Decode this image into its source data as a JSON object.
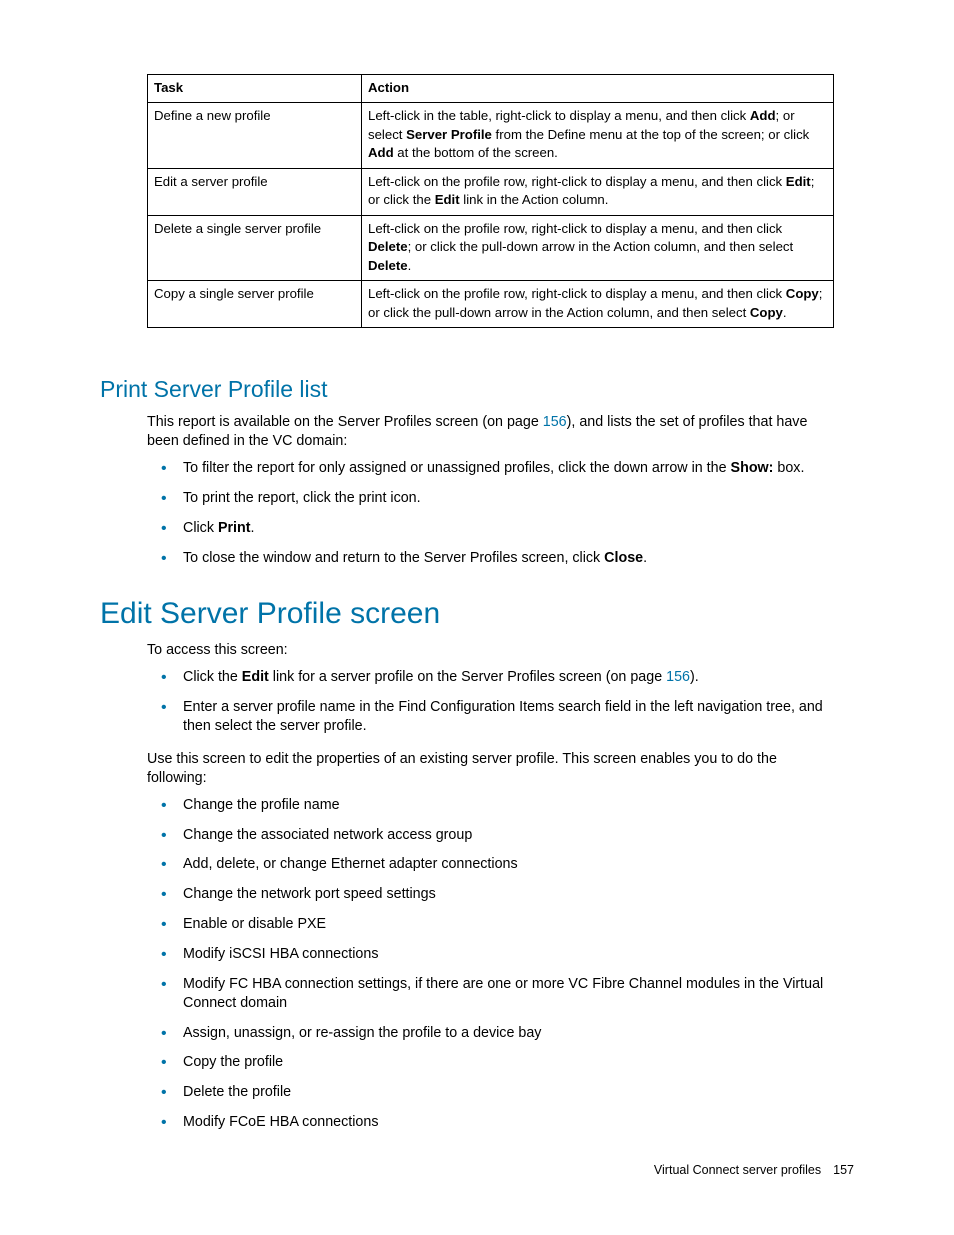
{
  "table": {
    "headers": {
      "task": "Task",
      "action": "Action"
    },
    "rows": [
      {
        "task": "Define a new profile",
        "action_pre1": "Left-click in the table, right-click to display a menu, and then click ",
        "action_b1": "Add",
        "action_mid1": "; or select ",
        "action_b2": "Server Profile",
        "action_mid2": " from the Define menu at the top of the screen; or click ",
        "action_b3": "Add",
        "action_post": " at the bottom of the screen."
      },
      {
        "task": "Edit a server profile",
        "action_pre1": "Left-click on the profile row, right-click to display a menu, and then click ",
        "action_b1": "Edit",
        "action_mid1": "; or click the ",
        "action_b2": "Edit",
        "action_post": " link in the Action column."
      },
      {
        "task": "Delete a single server profile",
        "action_pre1": "Left-click on the profile row, right-click to display a menu, and then click ",
        "action_b1": "Delete",
        "action_mid1": "; or click the pull-down arrow in the Action column, and then select ",
        "action_b2": "Delete",
        "action_post": "."
      },
      {
        "task": "Copy a single server profile",
        "action_pre1": "Left-click on the profile row, right-click to display a menu, and then click ",
        "action_b1": "Copy",
        "action_mid1": "; or click the pull-down arrow in the Action column, and then select ",
        "action_b2": "Copy",
        "action_post": "."
      }
    ]
  },
  "print_section": {
    "title": "Print Server Profile list",
    "intro_pre": "This report is available on the Server Profiles screen (on page ",
    "intro_link": "156",
    "intro_post": "), and lists the set of profiles that have been defined in the VC domain:",
    "bullets": [
      {
        "pre": "To filter the report for only assigned or unassigned profiles, click the down arrow in the ",
        "b": "Show:",
        "post": " box."
      },
      {
        "pre": "To print the report, click the print icon."
      },
      {
        "pre": "Click ",
        "b": "Print",
        "post": "."
      },
      {
        "pre": "To close the window and return to the Server Profiles screen, click ",
        "b": "Close",
        "post": "."
      }
    ]
  },
  "edit_section": {
    "title": "Edit Server Profile screen",
    "intro": "To access this screen:",
    "access_bullets": [
      {
        "pre": "Click the ",
        "b": "Edit",
        "mid": " link for a server profile on the Server Profiles screen (on page ",
        "link": "156",
        "post": ")."
      },
      {
        "pre": "Enter a server profile name in the Find Configuration Items search field in the left navigation tree, and then select the server profile."
      }
    ],
    "use_text": "Use this screen to edit the properties of an existing server profile. This screen enables you to do the following:",
    "capabilities": [
      "Change the profile name",
      "Change the associated network access group",
      "Add, delete, or change Ethernet adapter connections",
      "Change the network port speed settings",
      "Enable or disable PXE",
      "Modify iSCSI HBA connections",
      "Modify FC HBA connection settings, if there are one or more VC Fibre Channel modules in the Virtual Connect domain",
      "Assign, unassign, or re-assign the profile to a device bay",
      "Copy the profile",
      "Delete the profile",
      "Modify FCoE HBA connections"
    ]
  },
  "footer": {
    "label": "Virtual Connect server profiles",
    "page": "157"
  }
}
